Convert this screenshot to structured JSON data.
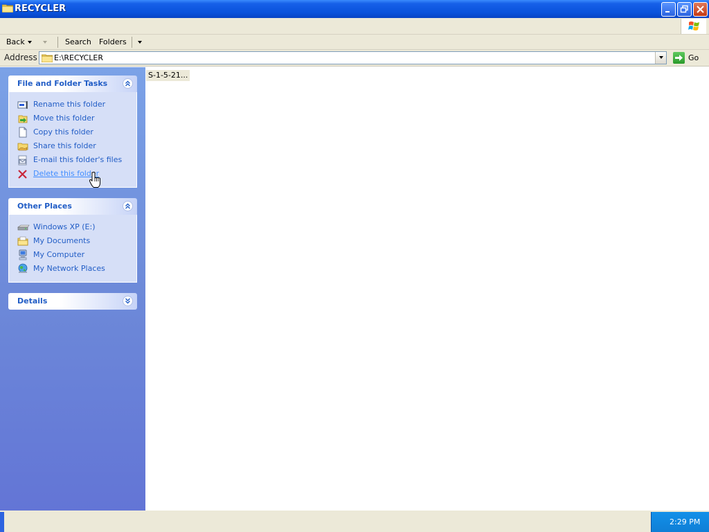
{
  "window": {
    "title": "RECYCLER"
  },
  "toolbar": {
    "back_label": "Back",
    "search_label": "Search",
    "folders_label": "Folders"
  },
  "address": {
    "label": "Address",
    "value": "E:\\RECYCLER",
    "go_label": "Go"
  },
  "tasks_panel": {
    "title": "File and Folder Tasks",
    "items": [
      {
        "label": "Rename this folder",
        "icon": "rename-icon"
      },
      {
        "label": "Move this folder",
        "icon": "move-icon"
      },
      {
        "label": "Copy this folder",
        "icon": "copy-icon"
      },
      {
        "label": "Share this folder",
        "icon": "share-icon"
      },
      {
        "label": "E-mail this folder's files",
        "icon": "email-icon"
      },
      {
        "label": "Delete this folder",
        "icon": "delete-icon"
      }
    ]
  },
  "places_panel": {
    "title": "Other Places",
    "items": [
      {
        "label": "Windows XP (E:)",
        "icon": "drive-icon"
      },
      {
        "label": "My Documents",
        "icon": "my-documents-icon"
      },
      {
        "label": "My Computer",
        "icon": "my-computer-icon"
      },
      {
        "label": "My Network Places",
        "icon": "network-places-icon"
      }
    ]
  },
  "details_panel": {
    "title": "Details"
  },
  "content": {
    "files": [
      {
        "name": "S-1-5-21..."
      }
    ]
  },
  "taskbar": {
    "clock": "2:29 PM"
  },
  "colors": {
    "titlebar": "#0a52dc",
    "taskpane": "#6d8ad9",
    "link": "#215dc6",
    "chrome": "#ece9d8"
  }
}
